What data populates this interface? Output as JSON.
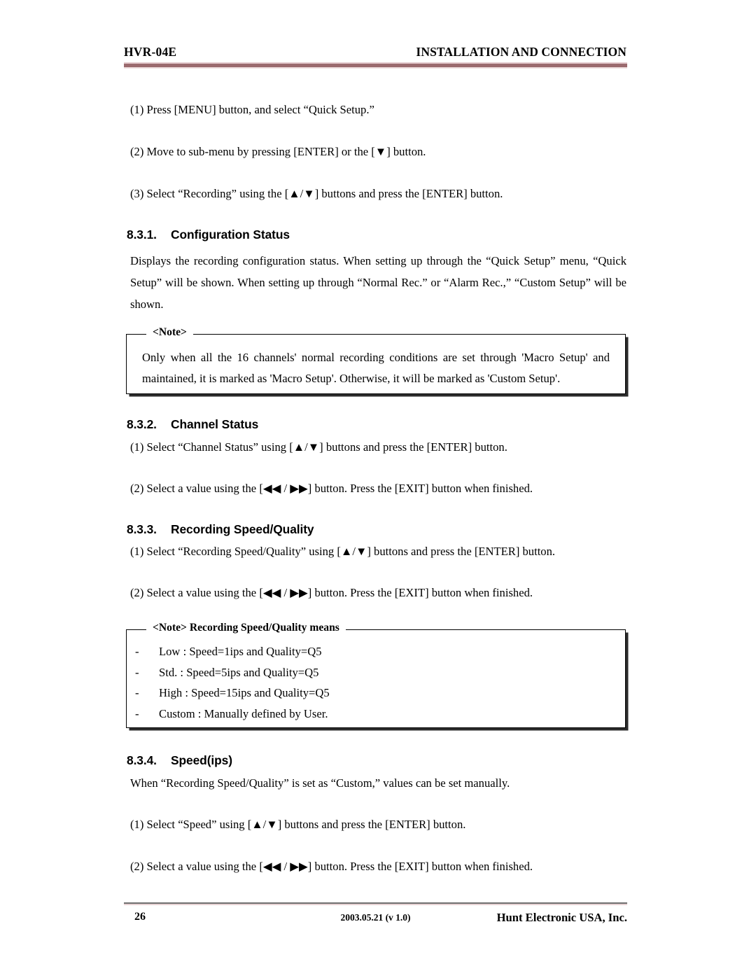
{
  "header": {
    "left": "HVR-04E",
    "right": "INSTALLATION AND CONNECTION"
  },
  "intro_steps": [
    "(1) Press [MENU] button, and select “Quick Setup.”",
    "(2) Move to sub-menu by pressing [ENTER] or the [▼] button.",
    "(3) Select “Recording” using the [▲/▼] buttons and press the [ENTER] button."
  ],
  "sections": [
    {
      "number": "8.3.1.",
      "title": "Configuration Status",
      "body": "Displays the recording configuration status. When setting up through the “Quick Setup” menu, “Quick Setup” will be shown. When setting up through “Normal Rec.” or “Alarm Rec.,” “Custom Setup” will be shown."
    },
    {
      "number": "8.3.2.",
      "title": "Channel Status",
      "step1": "(1) Select “Channel Status” using [▲/▼] buttons and press the [ENTER] button.",
      "step2": "(2) Select a value using the [◀◀ / ▶▶] button. Press the [EXIT] button when finished."
    },
    {
      "number": "8.3.3.",
      "title": "Recording Speed/Quality",
      "step1": "(1) Select “Recording Speed/Quality” using [▲/▼] buttons and press the [ENTER] button.",
      "step2": "(2) Select a value using the [◀◀ / ▶▶] button. Press the [EXIT] button when finished."
    },
    {
      "number": "8.3.4.",
      "title": "Speed(ips)",
      "body": "When “Recording Speed/Quality” is set as “Custom,” values can be set manually.",
      "step1": "(1) Select “Speed” using [▲/▼] buttons and press the [ENTER] button.",
      "step2": "(2) Select a value using the [◀◀ / ▶▶] button. Press the [EXIT] button when finished."
    }
  ],
  "note_box_1": {
    "legend": "<Note>",
    "body": "Only when all the 16 channels' normal recording conditions are set through 'Macro Setup' and maintained, it is marked as 'Macro Setup'. Otherwise, it will be marked as 'Custom Setup'."
  },
  "note_box_2": {
    "legend": "<Note> Recording Speed/Quality means",
    "dash": "-",
    "items": [
      "Low : Speed=1ips and Quality=Q5",
      "Std. : Speed=5ips and Quality=Q5",
      "High : Speed=15ips and Quality=Q5",
      "Custom : Manually defined by User."
    ]
  },
  "footer": {
    "page_number": "26",
    "date_version": "2003.05.21 (v 1.0)",
    "company": "Hunt Electronic USA, Inc."
  },
  "colors": {
    "header_rule": "#9b6a6e",
    "header_rule_light": "#e3c9cc",
    "footer_rule": "#6f6f6f",
    "footer_rule_pink": "#e8d3d5"
  }
}
